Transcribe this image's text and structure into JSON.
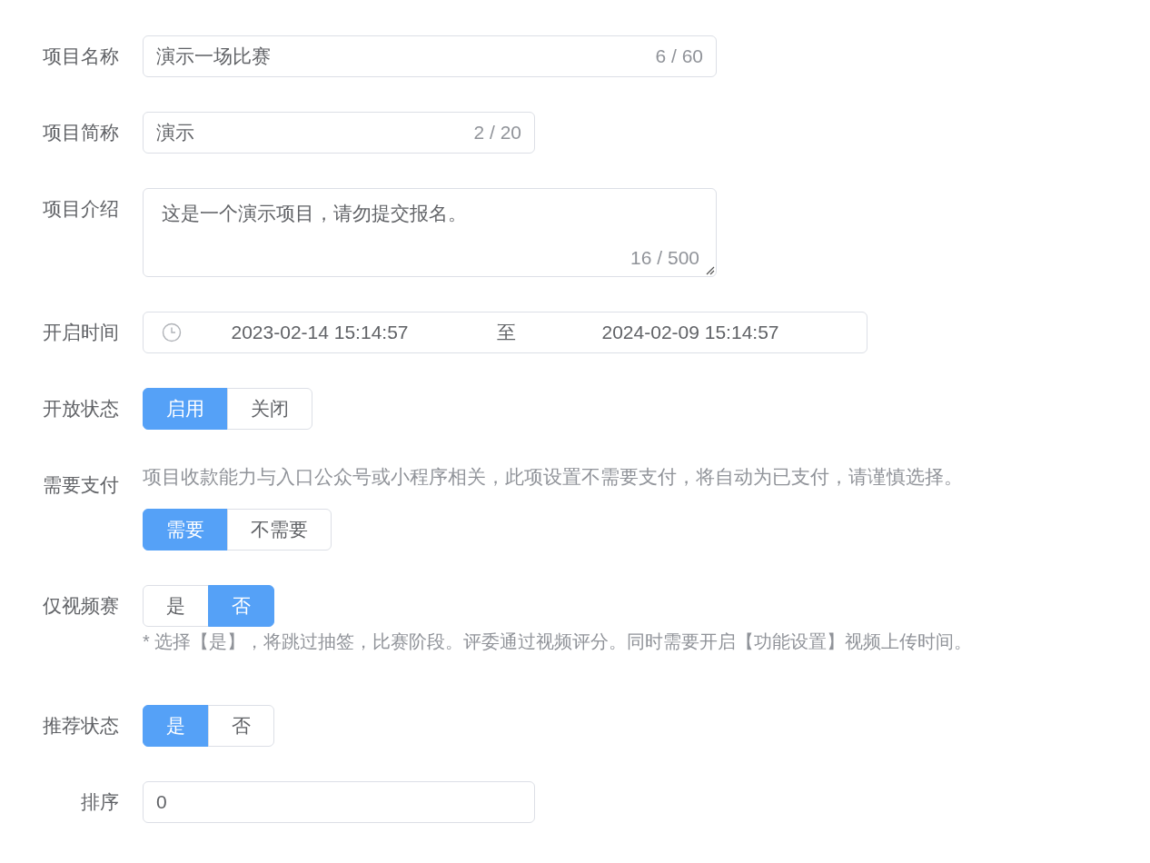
{
  "fields": [
    {
      "label": "项目名称",
      "kind": "input",
      "value": "演示一场比赛",
      "counter": "6 / 60"
    },
    {
      "label": "项目简称",
      "kind": "input",
      "value": "演示",
      "counter": "2 / 20"
    },
    {
      "label": "项目介绍",
      "kind": "textarea",
      "value": "这是一个演示项目，请勿提交报名。",
      "counter": "16 / 500"
    },
    {
      "label": "开启时间",
      "kind": "daterange",
      "start": "2023-02-14 15:14:57",
      "separator": "至",
      "end": "2024-02-09 15:14:57"
    },
    {
      "label": "开放状态",
      "kind": "radio",
      "options": [
        {
          "label": "启用",
          "selected": true
        },
        {
          "label": "关闭",
          "selected": false
        }
      ]
    },
    {
      "label": "需要支付",
      "kind": "radio",
      "hint_above": "项目收款能力与入口公众号或小程序相关，此项设置不需要支付，将自动为已支付，请谨慎选择。",
      "options": [
        {
          "label": "需要",
          "selected": true
        },
        {
          "label": "不需要",
          "selected": false
        }
      ]
    },
    {
      "label": "仅视频赛",
      "kind": "radio",
      "options": [
        {
          "label": "是",
          "selected": false
        },
        {
          "label": "否",
          "selected": true
        }
      ],
      "hint_below": "* 选择【是】，将跳过抽签，比赛阶段。评委通过视频评分。同时需要开启【功能设置】视频上传时间。"
    },
    {
      "label": "推荐状态",
      "kind": "radio",
      "options": [
        {
          "label": "是",
          "selected": true
        },
        {
          "label": "否",
          "selected": false
        }
      ]
    },
    {
      "label": "排序",
      "kind": "input",
      "value": "0"
    }
  ]
}
